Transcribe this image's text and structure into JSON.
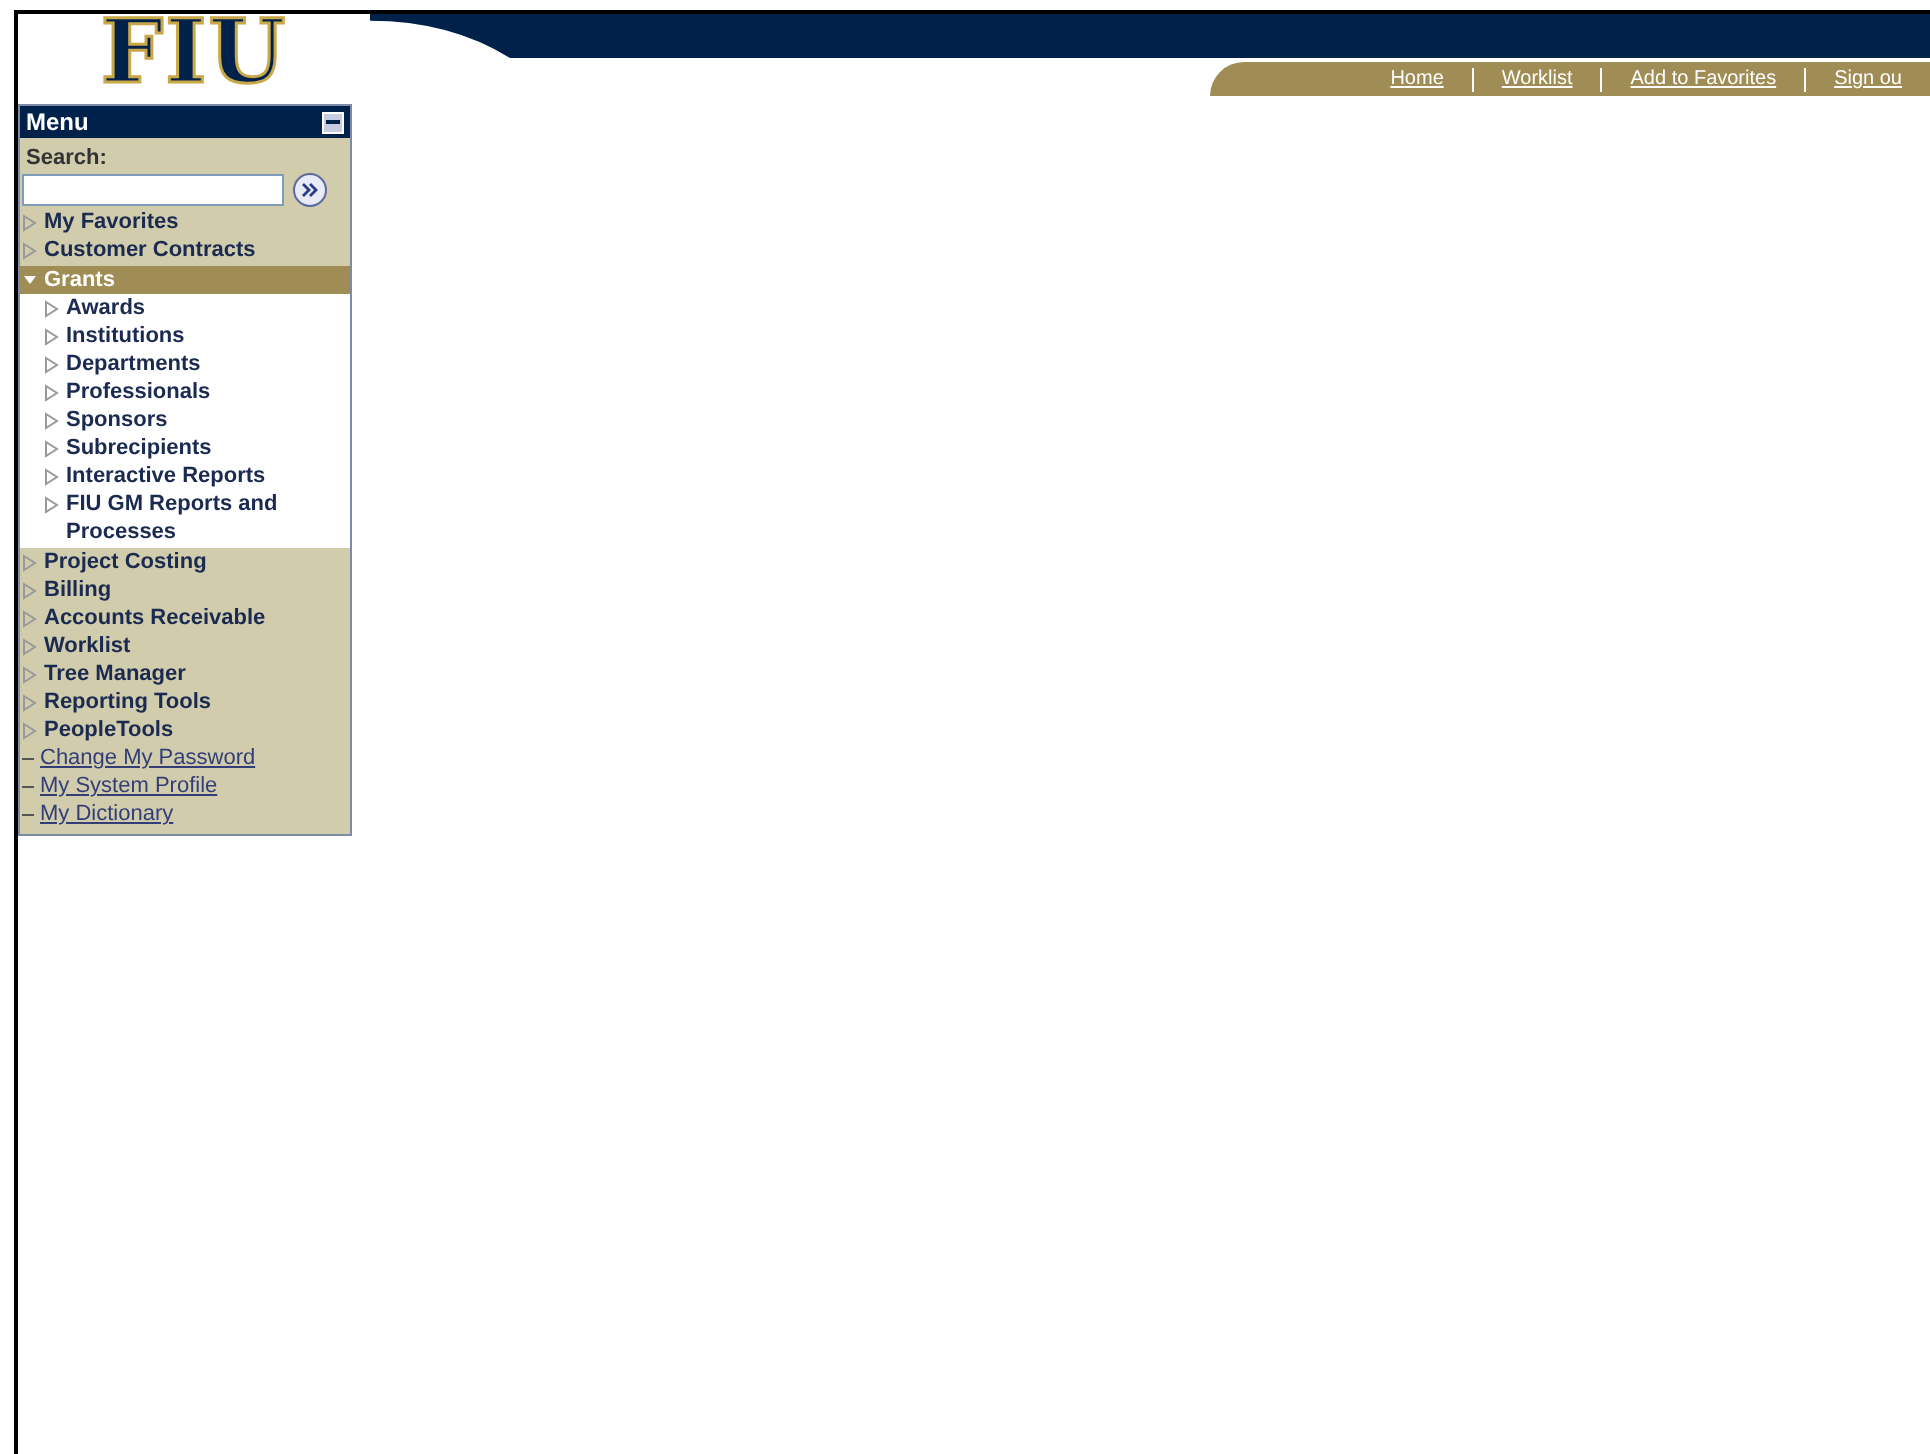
{
  "logo": {
    "text": "FIU"
  },
  "nav_links": [
    "Home",
    "Worklist",
    "Add to Favorites",
    "Sign ou"
  ],
  "menu": {
    "title": "Menu",
    "search_label": "Search:",
    "items": [
      {
        "kind": "folder",
        "label": "My Favorites",
        "expanded": false
      },
      {
        "kind": "folder",
        "label": "Customer Contracts",
        "expanded": false
      },
      {
        "kind": "folder",
        "label": "Grants",
        "expanded": true,
        "children": [
          {
            "label": "Awards",
            "expanded": false
          },
          {
            "label": "Institutions",
            "expanded": false
          },
          {
            "label": "Departments",
            "expanded": false
          },
          {
            "label": "Professionals",
            "expanded": false
          },
          {
            "label": "Sponsors",
            "expanded": false
          },
          {
            "label": "Subrecipients",
            "expanded": false
          },
          {
            "label": "Interactive Reports",
            "expanded": false
          },
          {
            "label": "FIU GM Reports and Processes",
            "expanded": false
          }
        ]
      },
      {
        "kind": "folder",
        "label": "Project Costing",
        "expanded": false
      },
      {
        "kind": "folder",
        "label": "Billing",
        "expanded": false
      },
      {
        "kind": "folder",
        "label": "Accounts Receivable",
        "expanded": false
      },
      {
        "kind": "folder",
        "label": "Worklist",
        "expanded": false
      },
      {
        "kind": "folder",
        "label": "Tree Manager",
        "expanded": false
      },
      {
        "kind": "folder",
        "label": "Reporting Tools",
        "expanded": false
      },
      {
        "kind": "folder",
        "label": "PeopleTools",
        "expanded": false
      },
      {
        "kind": "link",
        "label": "Change My Password"
      },
      {
        "kind": "link",
        "label": "My System Profile"
      },
      {
        "kind": "link",
        "label": "My Dictionary"
      }
    ]
  }
}
